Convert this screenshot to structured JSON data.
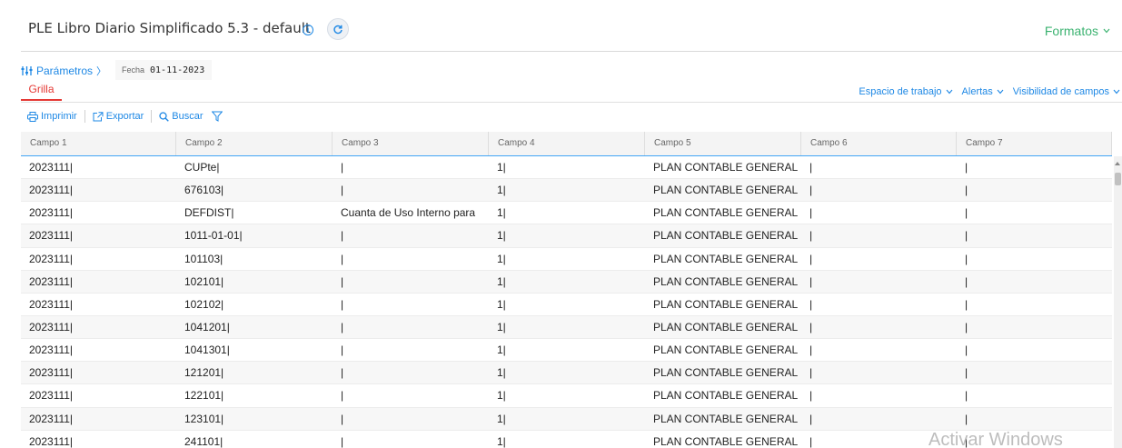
{
  "header": {
    "title": "PLE Libro Diario Simplificado 5.3 - default",
    "info_glyph": "i",
    "formatos_label": "Formatos"
  },
  "params": {
    "label": "Parámetros",
    "chevron": "〉",
    "fecha_label": "Fecha",
    "fecha_value": "01-11-2023"
  },
  "tabs": [
    {
      "label": "Grilla",
      "active": true
    }
  ],
  "right_links": [
    {
      "label": "Espacio de trabajo"
    },
    {
      "label": "Alertas"
    },
    {
      "label": "Visibilidad de campos"
    }
  ],
  "toolbar": {
    "imprimir": "Imprimir",
    "exportar": "Exportar",
    "buscar": "Buscar"
  },
  "grid": {
    "columns": [
      "Campo 1",
      "Campo 2",
      "Campo 3",
      "Campo 4",
      "Campo 5",
      "Campo 6",
      "Campo 7"
    ],
    "rows": [
      [
        "2023111|",
        "CUPte|",
        "|",
        "1|",
        "PLAN CONTABLE GENERAL",
        "|",
        "|"
      ],
      [
        "2023111|",
        "676103|",
        "|",
        "1|",
        "PLAN CONTABLE GENERAL",
        "|",
        "|"
      ],
      [
        "2023111|",
        "DEFDIST|",
        "Cuanta de Uso Interno para",
        "1|",
        "PLAN CONTABLE GENERAL",
        "|",
        "|"
      ],
      [
        "2023111|",
        "1011-01-01|",
        "|",
        "1|",
        "PLAN CONTABLE GENERAL",
        "|",
        "|"
      ],
      [
        "2023111|",
        "101103|",
        "|",
        "1|",
        "PLAN CONTABLE GENERAL",
        "|",
        "|"
      ],
      [
        "2023111|",
        "102101|",
        "|",
        "1|",
        "PLAN CONTABLE GENERAL",
        "|",
        "|"
      ],
      [
        "2023111|",
        "102102|",
        "|",
        "1|",
        "PLAN CONTABLE GENERAL",
        "|",
        "|"
      ],
      [
        "2023111|",
        "1041201|",
        "|",
        "1|",
        "PLAN CONTABLE GENERAL",
        "|",
        "|"
      ],
      [
        "2023111|",
        "1041301|",
        "|",
        "1|",
        "PLAN CONTABLE GENERAL",
        "|",
        "|"
      ],
      [
        "2023111|",
        "121201|",
        "|",
        "1|",
        "PLAN CONTABLE GENERAL",
        "|",
        "|"
      ],
      [
        "2023111|",
        "122101|",
        "|",
        "1|",
        "PLAN CONTABLE GENERAL",
        "|",
        "|"
      ],
      [
        "2023111|",
        "123101|",
        "|",
        "1|",
        "PLAN CONTABLE GENERAL",
        "|",
        "|"
      ],
      [
        "2023111|",
        "241101|",
        "|",
        "1|",
        "PLAN CONTABLE GENERAL",
        "|",
        "|"
      ]
    ]
  },
  "watermark": "Activar Windows",
  "colors": {
    "accent": "#1e88e5",
    "active_tab": "#e53935",
    "formatos": "#3cb371"
  }
}
